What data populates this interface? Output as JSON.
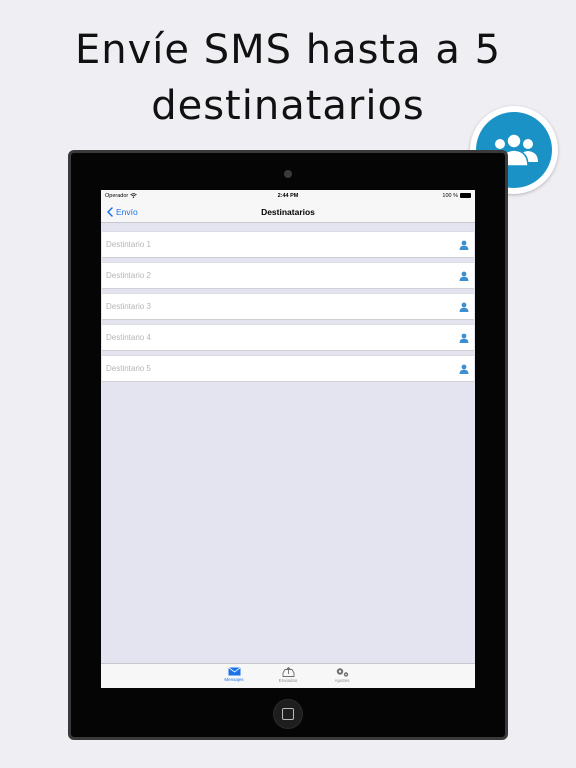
{
  "headline": {
    "line1": "Envíe SMS hasta a 5",
    "line2": "destinatarios"
  },
  "badge": {
    "icon": "contacts-group-icon",
    "color": "#1a92c6"
  },
  "status_bar": {
    "carrier": "Operador",
    "time": "2:44 PM",
    "battery": "100 %"
  },
  "nav": {
    "back_label": "Envío",
    "title": "Destinatarios"
  },
  "recipients": [
    {
      "placeholder": "Destintario 1",
      "icon": "contact-person-icon"
    },
    {
      "placeholder": "Destintario 2",
      "icon": "contact-person-icon"
    },
    {
      "placeholder": "Destintario 3",
      "icon": "contact-person-icon"
    },
    {
      "placeholder": "Destintario 4",
      "icon": "contact-person-icon"
    },
    {
      "placeholder": "Destintario 5",
      "icon": "contact-person-icon"
    }
  ],
  "tabs": [
    {
      "label": "Mensajes",
      "icon": "envelope-icon",
      "active": true
    },
    {
      "label": "Enviados",
      "icon": "outbox-tray-icon",
      "active": false
    },
    {
      "label": "Ajustes",
      "icon": "gears-icon",
      "active": false
    }
  ],
  "colors": {
    "accent": "#1a73e8",
    "person_icon": "#3b8fd1",
    "background": "#efeef3"
  }
}
